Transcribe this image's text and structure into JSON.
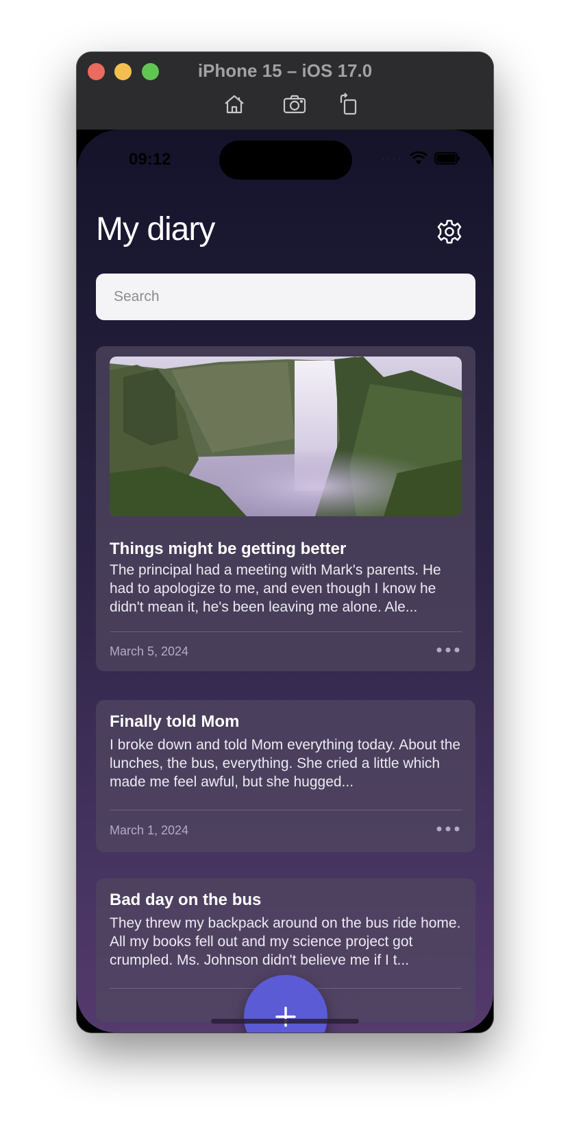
{
  "window": {
    "title": "iPhone 15 – iOS 17.0",
    "toolbar_icons": [
      "home-icon",
      "screenshot-icon",
      "rotate-icon"
    ]
  },
  "status_bar": {
    "time": "09:12",
    "icons": [
      "cellular-icon",
      "wifi-icon",
      "battery-icon"
    ]
  },
  "header": {
    "title": "My diary",
    "settings_icon": "gear-icon"
  },
  "search": {
    "placeholder": "Search",
    "value": ""
  },
  "entries": [
    {
      "title": "Things might be getting better",
      "body": "The principal had a meeting with Mark's parents. He had to apologize to me, and even though I know he didn't mean it, he's been leaving me alone. Ale...",
      "date": "March 5, 2024",
      "has_image": true
    },
    {
      "title": "Finally told Mom",
      "body": "I broke down and told Mom everything today. About the lunches, the bus, everything. She cried a little which made me feel awful, but she hugged...",
      "date": "March 1, 2024",
      "has_image": false
    },
    {
      "title": "Bad day on the bus",
      "body": "They threw my backpack around on the bus ride home. All my books fell out and my science project got crumpled. Ms. Johnson didn't believe me if I t...",
      "date": "",
      "has_image": false
    }
  ],
  "fab": {
    "icon": "plus-icon"
  },
  "colors": {
    "accent": "#5b5bd6",
    "card_background": "#4a4058",
    "background_top": "#14132a",
    "background_bottom": "#553a6d"
  }
}
